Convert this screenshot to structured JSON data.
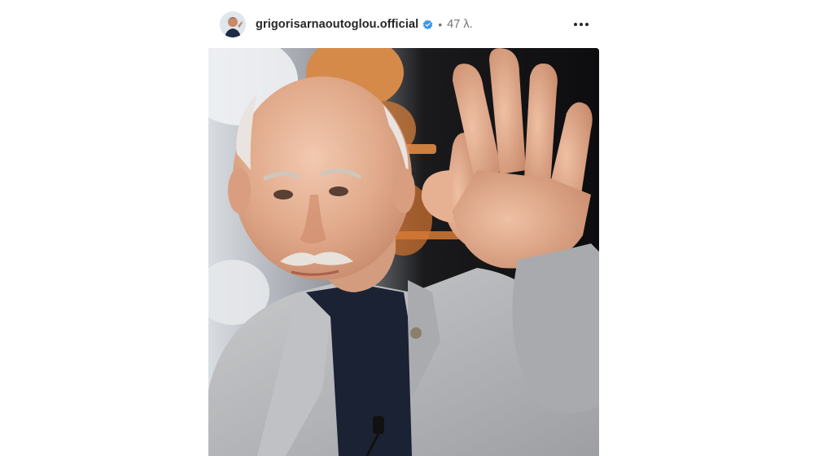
{
  "post": {
    "username": "grigorisarnaoutoglou.official",
    "separator": "•",
    "time": "47 λ.",
    "verified": true,
    "more_icon": "more-horizontal-icon",
    "avatar_icon": "avatar"
  },
  "colors": {
    "verified_blue": "#3897f0",
    "text_primary": "#262626",
    "text_secondary": "#737373"
  }
}
